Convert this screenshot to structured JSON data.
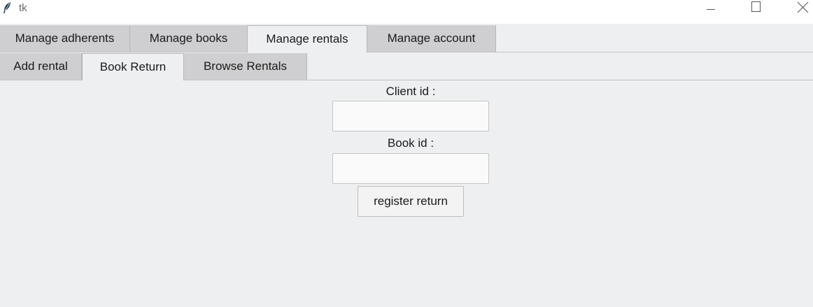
{
  "window": {
    "title": "tk",
    "icon": "feather-icon",
    "controls": [
      "minimize-icon",
      "maximize-icon",
      "close-icon"
    ]
  },
  "main_tabs": [
    {
      "label": "Manage adherents",
      "selected": false
    },
    {
      "label": "Manage books",
      "selected": false
    },
    {
      "label": "Manage rentals",
      "selected": true
    },
    {
      "label": "Manage account",
      "selected": false
    }
  ],
  "sub_tabs": [
    {
      "label": "Add rental",
      "selected": false
    },
    {
      "label": "Book Return",
      "selected": true
    },
    {
      "label": "Browse Rentals",
      "selected": false
    }
  ],
  "form": {
    "client_id_label": "Client id :",
    "client_id_value": "",
    "book_id_label": "Book id :",
    "book_id_value": "",
    "submit_label": "register return"
  }
}
